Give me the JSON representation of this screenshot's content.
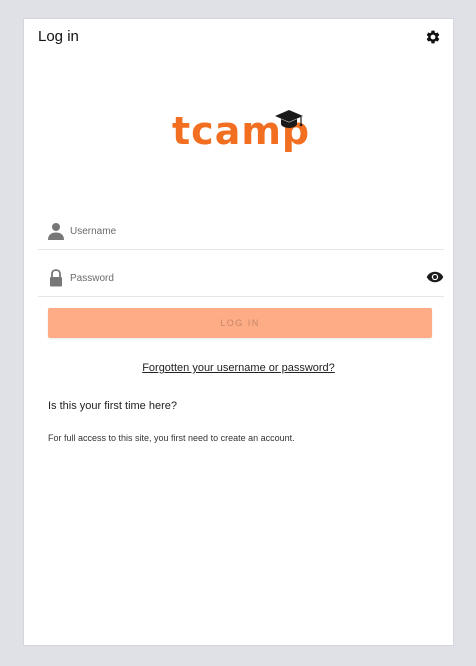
{
  "header": {
    "title": "Log in",
    "settings_icon": "gear-icon"
  },
  "logo": {
    "text": "tcamp",
    "icon": "graduation-cap-icon",
    "color": "#f26f21"
  },
  "form": {
    "username": {
      "placeholder": "Username",
      "value": "",
      "icon": "person-icon"
    },
    "password": {
      "placeholder": "Password",
      "value": "",
      "icon": "lock-icon",
      "toggle_icon": "eye-icon"
    },
    "login_button": {
      "label": "LOG IN",
      "background": "#fdac85",
      "text_color": "#c5876a"
    }
  },
  "links": {
    "forgot": "Forgotten your username or password?"
  },
  "signup": {
    "heading": "Is this your first time here?",
    "info": "For full access to this site, you first need to create an account."
  }
}
